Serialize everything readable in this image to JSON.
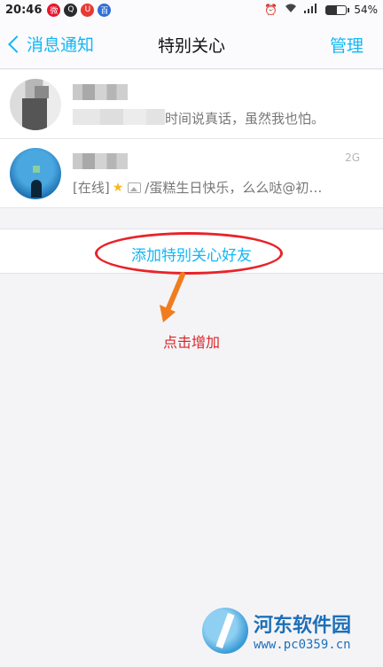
{
  "status_bar": {
    "time": "20:46",
    "battery_percent": "54%",
    "battery_level": 0.54,
    "icons": [
      "weibo-icon",
      "qq-icon",
      "browser-icon",
      "baidu-icon",
      "alarm-icon",
      "wifi-icon",
      "signal-icon",
      "battery-icon"
    ]
  },
  "nav": {
    "back_label": "消息通知",
    "title": "特别关心",
    "manage_label": "管理"
  },
  "contacts": [
    {
      "message_tail": "时间说真话，虽然我也怕。"
    },
    {
      "network": "2G",
      "status": "[在线]",
      "message": "/蛋糕生日快乐，么么哒@初…"
    }
  ],
  "add_friend_label": "添加特别关心好友",
  "annotation": "点击增加",
  "watermark": {
    "title": "河东软件园",
    "url": "www.pc0359.cn"
  },
  "colors": {
    "accent": "#12b7f5",
    "annotation_red": "#e8232a",
    "arrow_orange": "#f07c1e"
  }
}
